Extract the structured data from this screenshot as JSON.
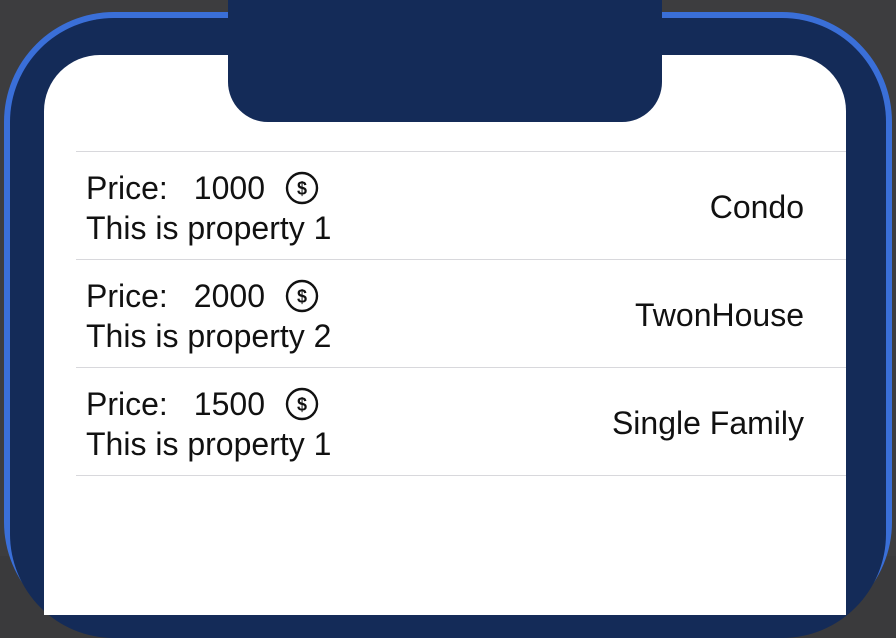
{
  "properties": [
    {
      "price_label": "Price:",
      "price": "1000",
      "price_icon": "dollar-circle-icon",
      "description": "This is property 1",
      "type": "Condo"
    },
    {
      "price_label": "Price:",
      "price": "2000",
      "price_icon": "dollar-circle-icon",
      "description": "This is property 2",
      "type": "TwonHouse"
    },
    {
      "price_label": "Price:",
      "price": "1500",
      "price_icon": "dollar-circle-icon",
      "description": "This is property 1",
      "type": "Single Family"
    }
  ],
  "colors": {
    "frame": "#3a6fd8",
    "bezel": "#142b58",
    "screen": "#ffffff",
    "separator": "#d8d8dc",
    "text": "#111111"
  }
}
